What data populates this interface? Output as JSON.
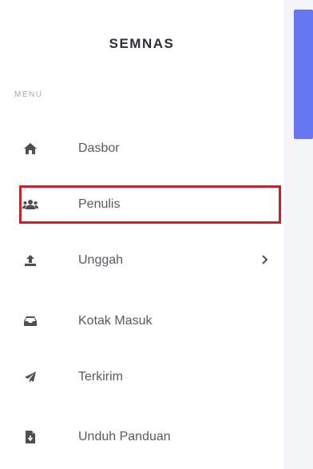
{
  "sidebar": {
    "brand": "SEMNAS",
    "menu_caption": "MENU",
    "items": [
      {
        "label": "Dasbor",
        "icon": "home-icon"
      },
      {
        "label": "Penulis",
        "icon": "users-icon",
        "highlighted": true
      },
      {
        "label": "Unggah",
        "icon": "upload-icon",
        "has_submenu": true
      },
      {
        "label": "Kotak Masuk",
        "icon": "inbox-icon"
      },
      {
        "label": "Terkirim",
        "icon": "paper-plane-icon"
      },
      {
        "label": "Unduh Panduan",
        "icon": "file-download-icon"
      }
    ]
  },
  "colors": {
    "accent": "#6777ef",
    "highlight_border": "#cc1f26",
    "text": "#565b61",
    "icon": "#4b5057"
  }
}
